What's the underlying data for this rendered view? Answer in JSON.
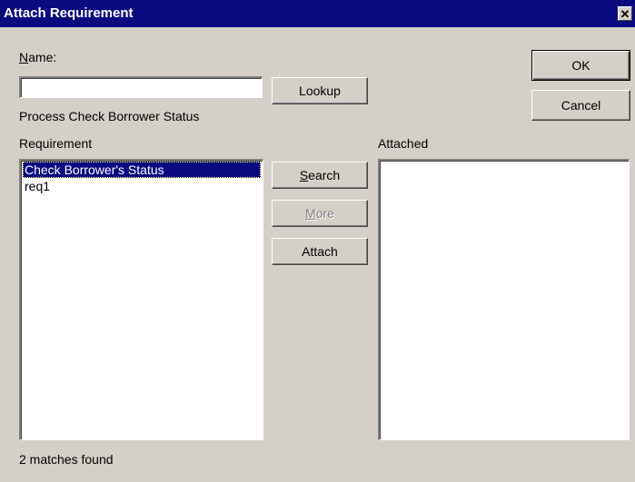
{
  "window": {
    "title": "Attach Requirement",
    "close_symbol": "✕"
  },
  "name_field": {
    "label_accel": "N",
    "label_rest": "ame:",
    "value": ""
  },
  "buttons": {
    "lookup": "Lookup",
    "ok": "OK",
    "cancel": "Cancel",
    "search_accel": "S",
    "search_rest": "earch",
    "more_accel": "M",
    "more_rest": "ore",
    "attach": "Attach"
  },
  "process_text": "Process Check Borrower Status",
  "requirement": {
    "label": "Requirement",
    "items": [
      {
        "label": "Check Borrower's Status",
        "selected": true
      },
      {
        "label": "req1",
        "selected": false
      }
    ]
  },
  "attached": {
    "label": "Attached",
    "items": []
  },
  "status": "2 matches found",
  "colors": {
    "titlebar": "#0a0a80",
    "selection": "#0a0a80",
    "face": "#d4d0c8"
  }
}
